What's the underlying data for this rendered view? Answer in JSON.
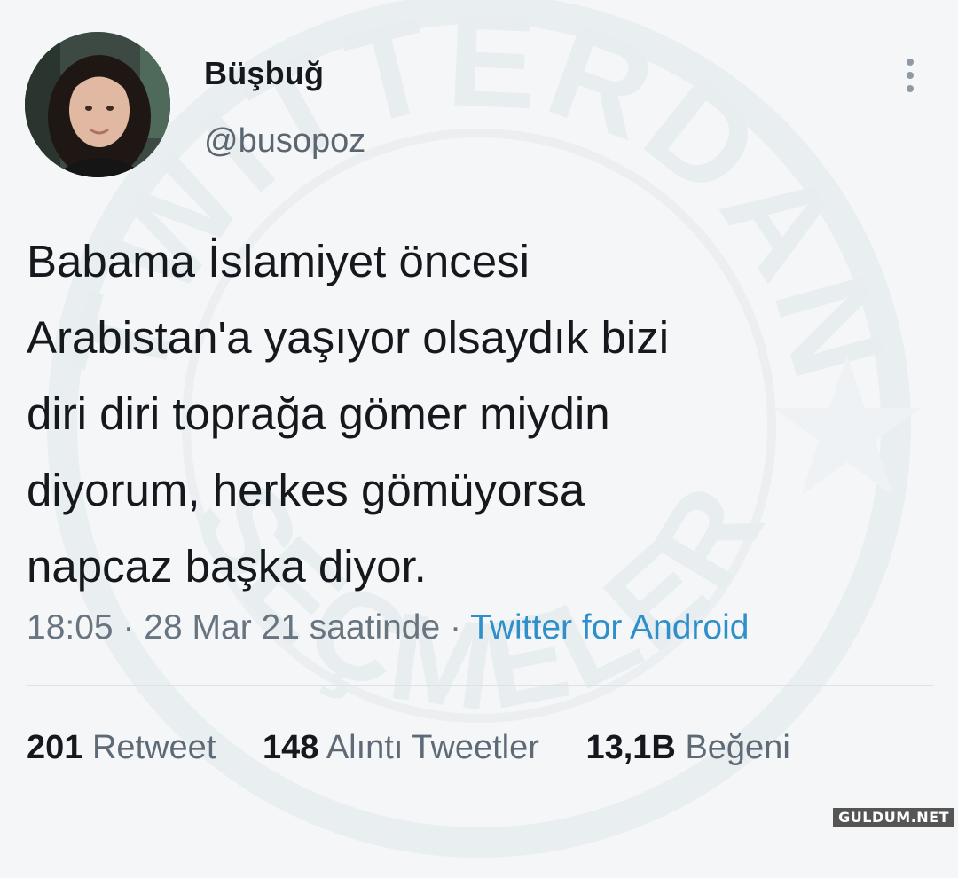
{
  "watermark": {
    "top_text": "TWITTERDAN",
    "bottom_text": "SEÇMELER"
  },
  "profile": {
    "display_name": "Büşbuğ",
    "handle": "@busopoz"
  },
  "tweet": {
    "lines": [
      "Babama İslamiyet öncesi",
      "Arabistan'a yaşıyor olsaydık bizi",
      "diri diri toprağa gömer miydin",
      "diyorum, herkes gömüyorsa",
      "napcaz başka diyor."
    ],
    "time": "18:05",
    "date": "28 Mar 21 saatinde",
    "separator": "·",
    "source": "Twitter for Android"
  },
  "stats": {
    "retweets": {
      "count": "201",
      "label": "Retweet"
    },
    "quotes": {
      "count": "148",
      "label": "Alıntı Tweetler"
    },
    "likes": {
      "count": "13,1B",
      "label": "Beğeni"
    }
  },
  "badge": "GULDUM.NET",
  "icons": {
    "more": "more-vertical-icon"
  },
  "colors": {
    "background": "#f4f6f7",
    "link": "#2f8fcb",
    "text": "#15191d",
    "muted": "#687580"
  }
}
